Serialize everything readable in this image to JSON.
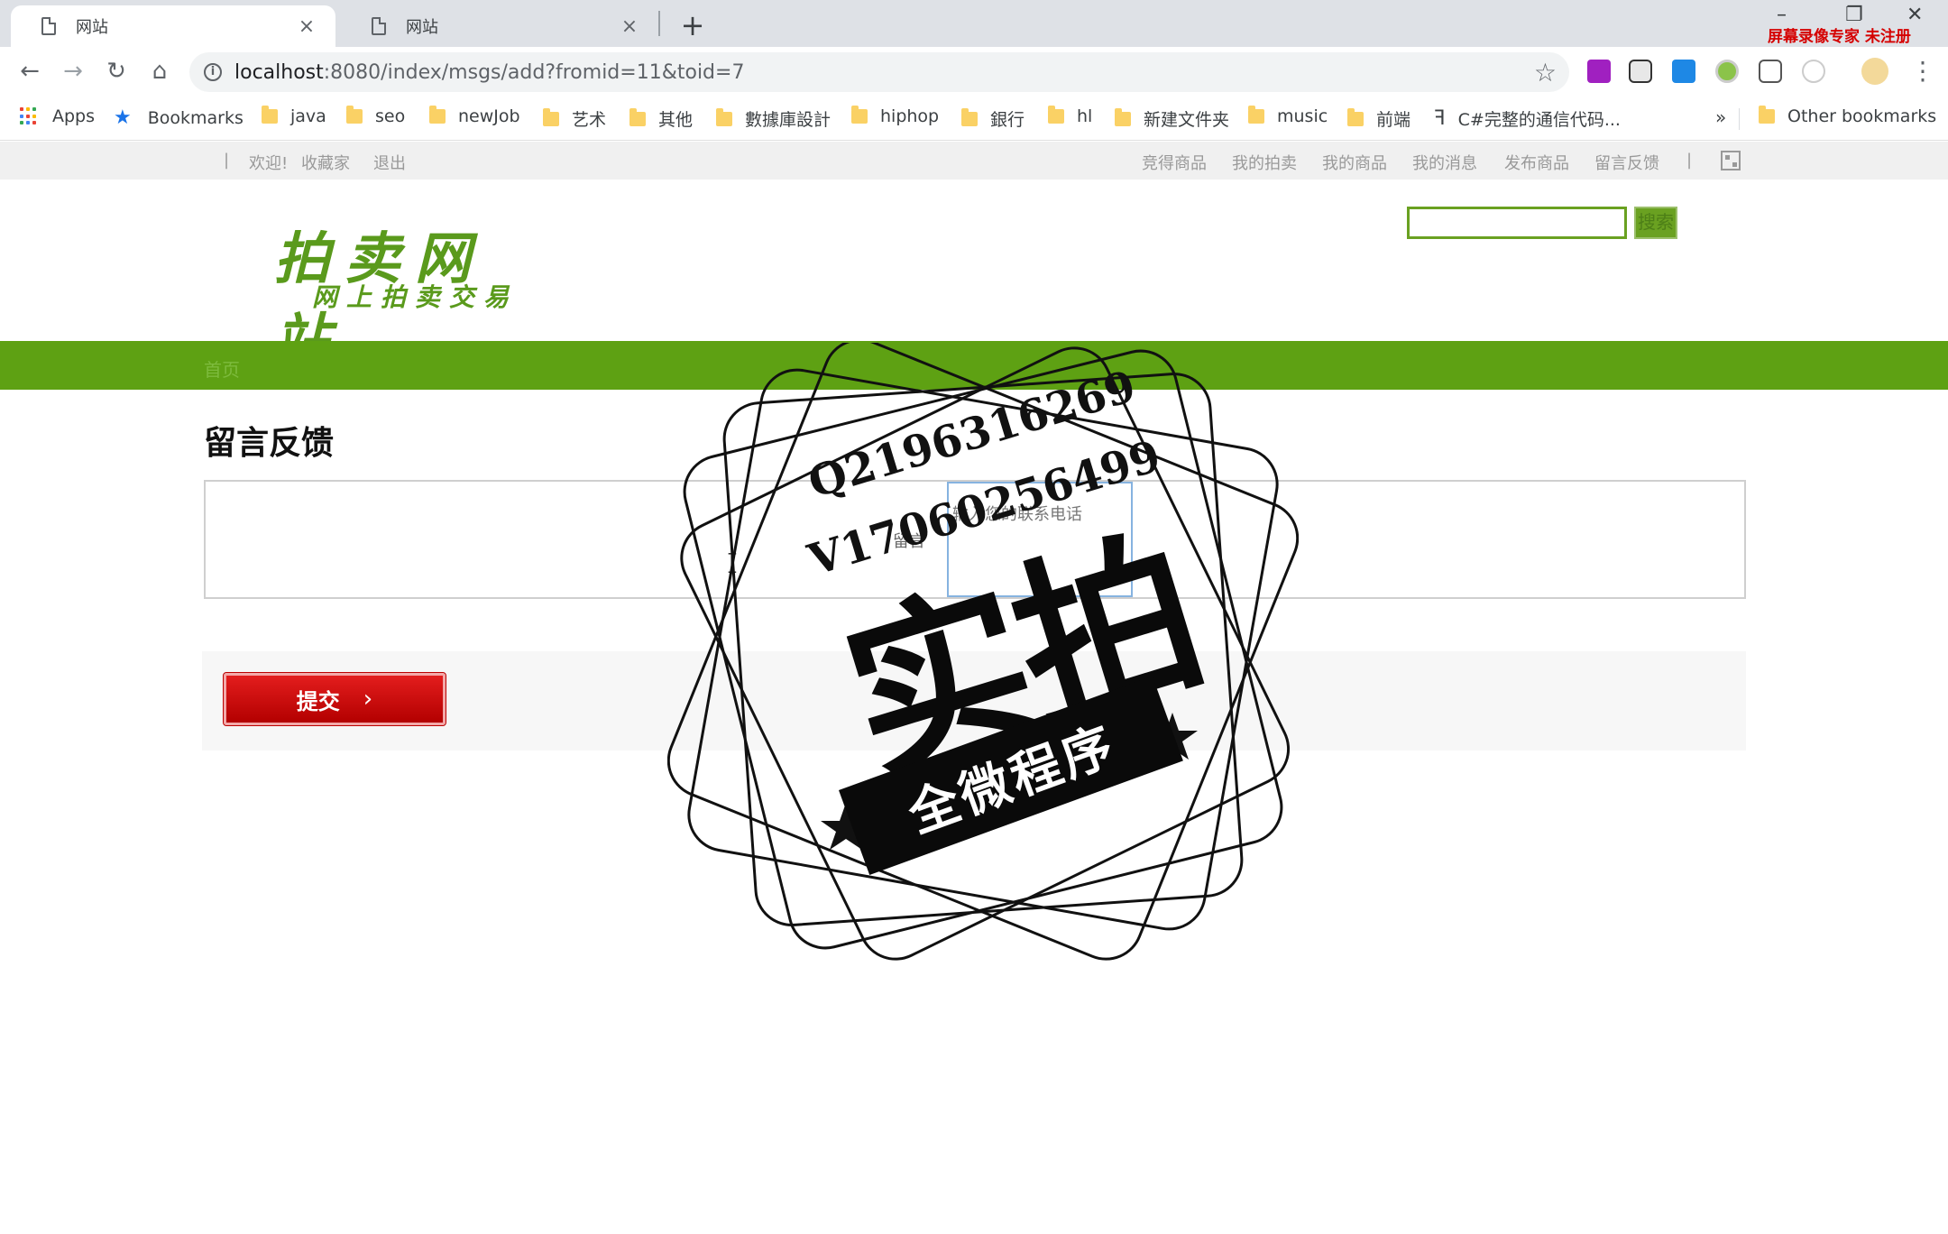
{
  "browser": {
    "tabs": [
      {
        "title": "网站",
        "close": "×",
        "active": true
      },
      {
        "title": "网站",
        "close": "×",
        "active": false
      }
    ],
    "new_tab": "+",
    "window_controls": {
      "minimize": "–",
      "restore": "❐",
      "close": "✕"
    },
    "recorder_badge": "屏幕录像专家 未注册",
    "nav": {
      "back": "←",
      "forward": "→",
      "reload": "↻",
      "home": "⌂"
    },
    "url_host": "localhost",
    "url_rest": ":8080/index/msgs/add?fromid=11&toid=7",
    "info_icon": "i",
    "bookmark_star": "☆",
    "menu": "⋮",
    "bookmarks": [
      {
        "label": "Apps",
        "icon": "apps-grid-icon"
      },
      {
        "label": "Bookmarks",
        "icon": "star-icon"
      },
      {
        "label": "java",
        "icon": "folder-icon"
      },
      {
        "label": "seo",
        "icon": "folder-icon"
      },
      {
        "label": "newJob",
        "icon": "folder-icon"
      },
      {
        "label": "艺术",
        "icon": "folder-icon"
      },
      {
        "label": "其他",
        "icon": "folder-icon"
      },
      {
        "label": "數據庫設計",
        "icon": "folder-icon"
      },
      {
        "label": "hiphop",
        "icon": "folder-icon"
      },
      {
        "label": "銀行",
        "icon": "folder-icon"
      },
      {
        "label": "hl",
        "icon": "folder-icon"
      },
      {
        "label": "新建文件夹",
        "icon": "folder-icon"
      },
      {
        "label": "music",
        "icon": "folder-icon"
      },
      {
        "label": "前端",
        "icon": "folder-icon"
      },
      {
        "label": "C#完整的通信代码...",
        "icon": "page-icon"
      }
    ],
    "bookmarks_overflow": "»",
    "other_bookmarks": "Other bookmarks"
  },
  "site": {
    "topbar": {
      "welcome": "欢迎!",
      "username": "收藏家",
      "logout": "退出",
      "links": [
        "竞得商品",
        "我的拍卖",
        "我的商品",
        "我的消息",
        "发布商品",
        "留言反馈"
      ]
    },
    "logo": {
      "line1": "拍卖网站",
      "line2": "网上拍卖交易"
    },
    "search": {
      "value": "",
      "button": "搜索"
    },
    "nav": {
      "home": "首页"
    },
    "page_title": "留言反馈",
    "form": {
      "message_label": "留言",
      "contact_placeholder": "输入您的联系电话",
      "submit": "提交",
      "submit_arrow": "›"
    }
  },
  "watermark": {
    "qq": "Q2196316269",
    "wechat": "V17060256499",
    "main": "实拍",
    "banner": "全微程序"
  },
  "colors": {
    "brand_green": "#5ea113",
    "submit_red": "#cc0000",
    "tabstrip": "#dee1e6"
  }
}
